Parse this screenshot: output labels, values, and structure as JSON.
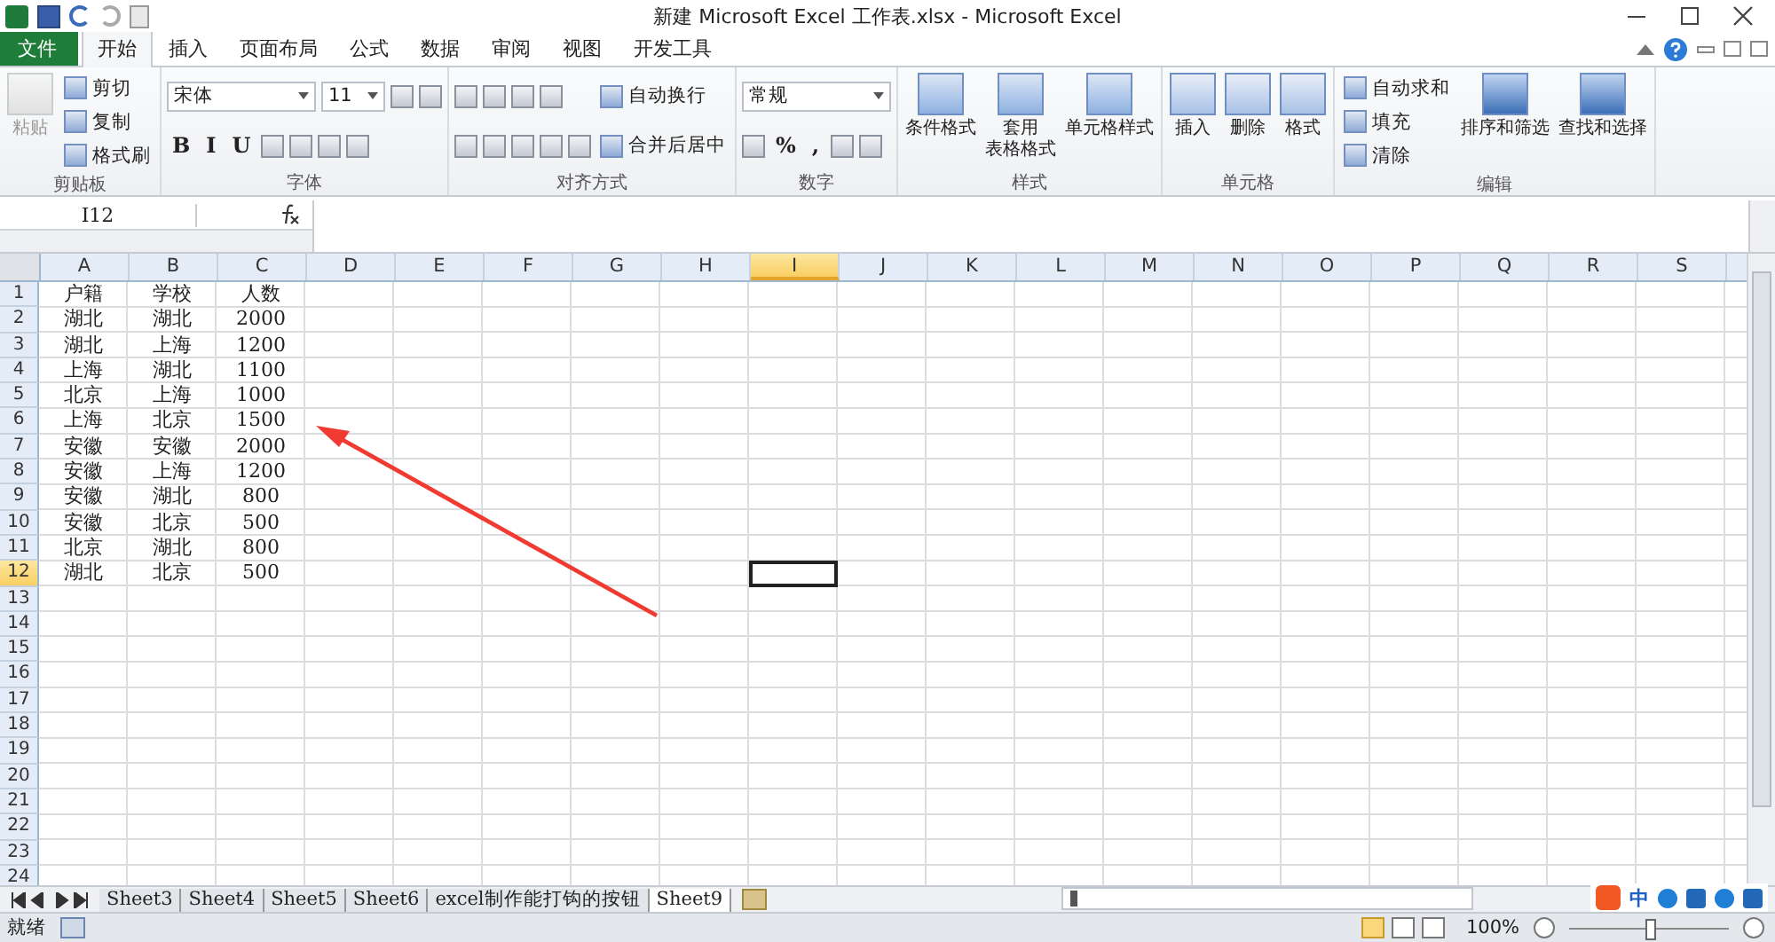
{
  "window": {
    "title": "新建 Microsoft Excel 工作表.xlsx - Microsoft Excel"
  },
  "tabs": [
    {
      "label": "文件",
      "kind": "file",
      "selected": false
    },
    {
      "label": "开始",
      "kind": "tab",
      "selected": true
    },
    {
      "label": "插入",
      "kind": "tab",
      "selected": false
    },
    {
      "label": "页面布局",
      "kind": "tab",
      "selected": false
    },
    {
      "label": "公式",
      "kind": "tab",
      "selected": false
    },
    {
      "label": "数据",
      "kind": "tab",
      "selected": false
    },
    {
      "label": "审阅",
      "kind": "tab",
      "selected": false
    },
    {
      "label": "视图",
      "kind": "tab",
      "selected": false
    },
    {
      "label": "开发工具",
      "kind": "tab",
      "selected": false
    }
  ],
  "ribbon": {
    "groups": [
      {
        "label": "剪贴板",
        "columns": [
          {
            "kind": "large",
            "lines": [
              "粘贴"
            ],
            "disabled": true
          },
          {
            "kind": "stack",
            "rows": [
              [
                {
                  "kind": "small",
                  "label": "剪切"
                }
              ],
              [
                {
                  "kind": "small",
                  "label": "复制"
                }
              ],
              [
                {
                  "kind": "small",
                  "label": "格式刷"
                }
              ]
            ]
          }
        ]
      },
      {
        "label": "字体",
        "columns": [
          {
            "kind": "stack",
            "rows": [
              [
                {
                  "kind": "wide-field",
                  "value": "宋体"
                },
                {
                  "kind": "narrow-field",
                  "value": "11"
                },
                {
                  "kind": "icon"
                },
                {
                  "kind": "icon"
                }
              ],
              [
                {
                  "kind": "glyph",
                  "label": "B"
                },
                {
                  "kind": "glyph",
                  "label": "I"
                },
                {
                  "kind": "glyph",
                  "label": "U"
                },
                {
                  "kind": "icon"
                },
                {
                  "kind": "icon"
                },
                {
                  "kind": "icon"
                },
                {
                  "kind": "icon"
                }
              ]
            ]
          }
        ]
      },
      {
        "label": "对齐方式",
        "columns": [
          {
            "kind": "stack",
            "rows": [
              [
                {
                  "kind": "icon"
                },
                {
                  "kind": "icon"
                },
                {
                  "kind": "icon"
                },
                {
                  "kind": "icon"
                }
              ],
              [
                {
                  "kind": "icon"
                },
                {
                  "kind": "icon"
                },
                {
                  "kind": "icon"
                },
                {
                  "kind": "icon"
                },
                {
                  "kind": "icon"
                }
              ]
            ]
          },
          {
            "kind": "stack",
            "rows": [
              [
                {
                  "kind": "small",
                  "label": "自动换行"
                }
              ],
              [
                {
                  "kind": "small",
                  "label": "合并后居中"
                }
              ]
            ]
          }
        ]
      },
      {
        "label": "数字",
        "columns": [
          {
            "kind": "stack",
            "rows": [
              [
                {
                  "kind": "wide-field",
                  "value": "常规"
                }
              ],
              [
                {
                  "kind": "icon"
                },
                {
                  "kind": "glyph",
                  "label": "%"
                },
                {
                  "kind": "glyph",
                  "label": ","
                },
                {
                  "kind": "icon"
                },
                {
                  "kind": "icon"
                }
              ]
            ]
          }
        ]
      },
      {
        "label": "样式",
        "columns": [
          {
            "kind": "large",
            "lines": [
              "条件格式"
            ]
          },
          {
            "kind": "large",
            "lines": [
              "套用",
              "表格格式"
            ]
          },
          {
            "kind": "large",
            "lines": [
              "单元格样式"
            ]
          }
        ]
      },
      {
        "label": "单元格",
        "columns": [
          {
            "kind": "large",
            "lines": [
              "插入"
            ]
          },
          {
            "kind": "large",
            "lines": [
              "删除"
            ]
          },
          {
            "kind": "large",
            "lines": [
              "格式"
            ]
          }
        ]
      },
      {
        "label": "编辑",
        "columns": [
          {
            "kind": "stack",
            "rows": [
              [
                {
                  "kind": "small",
                  "label": "自动求和"
                }
              ],
              [
                {
                  "kind": "small",
                  "label": "填充"
                }
              ],
              [
                {
                  "kind": "small",
                  "label": "清除"
                }
              ]
            ]
          },
          {
            "kind": "large",
            "lines": [
              "排序和筛选"
            ]
          },
          {
            "kind": "large",
            "lines": [
              "查找和选择"
            ]
          }
        ]
      }
    ]
  },
  "formula_bar": {
    "name_box": "I12"
  },
  "columns": [
    {
      "label": "A",
      "selected": false
    },
    {
      "label": "B",
      "selected": false
    },
    {
      "label": "C",
      "selected": false
    },
    {
      "label": "D",
      "selected": false
    },
    {
      "label": "E",
      "selected": false
    },
    {
      "label": "F",
      "selected": false
    },
    {
      "label": "G",
      "selected": false
    },
    {
      "label": "H",
      "selected": false
    },
    {
      "label": "I",
      "selected": true
    },
    {
      "label": "J",
      "selected": false
    },
    {
      "label": "K",
      "selected": false
    },
    {
      "label": "L",
      "selected": false
    },
    {
      "label": "M",
      "selected": false
    },
    {
      "label": "N",
      "selected": false
    },
    {
      "label": "O",
      "selected": false
    },
    {
      "label": "P",
      "selected": false
    },
    {
      "label": "Q",
      "selected": false
    },
    {
      "label": "R",
      "selected": false
    },
    {
      "label": "S",
      "selected": false
    }
  ],
  "rows": [
    {
      "number": "1",
      "selected": false,
      "cells": [
        "户籍",
        "学校",
        "人数"
      ]
    },
    {
      "number": "2",
      "selected": false,
      "cells": [
        "湖北",
        "湖北",
        "2000"
      ]
    },
    {
      "number": "3",
      "selected": false,
      "cells": [
        "湖北",
        "上海",
        "1200"
      ]
    },
    {
      "number": "4",
      "selected": false,
      "cells": [
        "上海",
        "湖北",
        "1100"
      ]
    },
    {
      "number": "5",
      "selected": false,
      "cells": [
        "北京",
        "上海",
        "1000"
      ]
    },
    {
      "number": "6",
      "selected": false,
      "cells": [
        "上海",
        "北京",
        "1500"
      ]
    },
    {
      "number": "7",
      "selected": false,
      "cells": [
        "安徽",
        "安徽",
        "2000"
      ]
    },
    {
      "number": "8",
      "selected": false,
      "cells": [
        "安徽",
        "上海",
        "1200"
      ]
    },
    {
      "number": "9",
      "selected": false,
      "cells": [
        "安徽",
        "湖北",
        "800"
      ]
    },
    {
      "number": "10",
      "selected": false,
      "cells": [
        "安徽",
        "北京",
        "500"
      ]
    },
    {
      "number": "11",
      "selected": false,
      "cells": [
        "北京",
        "湖北",
        "800"
      ]
    },
    {
      "number": "12",
      "selected": true,
      "cells": [
        "湖北",
        "北京",
        "500"
      ]
    },
    {
      "number": "13",
      "selected": false,
      "cells": []
    },
    {
      "number": "14",
      "selected": false,
      "cells": []
    },
    {
      "number": "15",
      "selected": false,
      "cells": []
    },
    {
      "number": "16",
      "selected": false,
      "cells": []
    },
    {
      "number": "17",
      "selected": false,
      "cells": []
    },
    {
      "number": "18",
      "selected": false,
      "cells": []
    },
    {
      "number": "19",
      "selected": false,
      "cells": []
    },
    {
      "number": "20",
      "selected": false,
      "cells": []
    },
    {
      "number": "21",
      "selected": false,
      "cells": []
    },
    {
      "number": "22",
      "selected": false,
      "cells": []
    },
    {
      "number": "23",
      "selected": false,
      "cells": []
    },
    {
      "number": "24",
      "selected": false,
      "cells": []
    }
  ],
  "sheet_tabs": [
    {
      "label": "Sheet3",
      "selected": false
    },
    {
      "label": "Sheet4",
      "selected": false
    },
    {
      "label": "Sheet5",
      "selected": false
    },
    {
      "label": "Sheet6",
      "selected": false
    },
    {
      "label": "excel制作能打钩的按钮",
      "selected": false
    },
    {
      "label": "Sheet9",
      "selected": true
    }
  ],
  "ime_bar": {
    "mode": "中"
  },
  "status_bar": {
    "status": "就绪",
    "zoom": "100%",
    "zoom_level": {
      "level": 0.5
    }
  }
}
